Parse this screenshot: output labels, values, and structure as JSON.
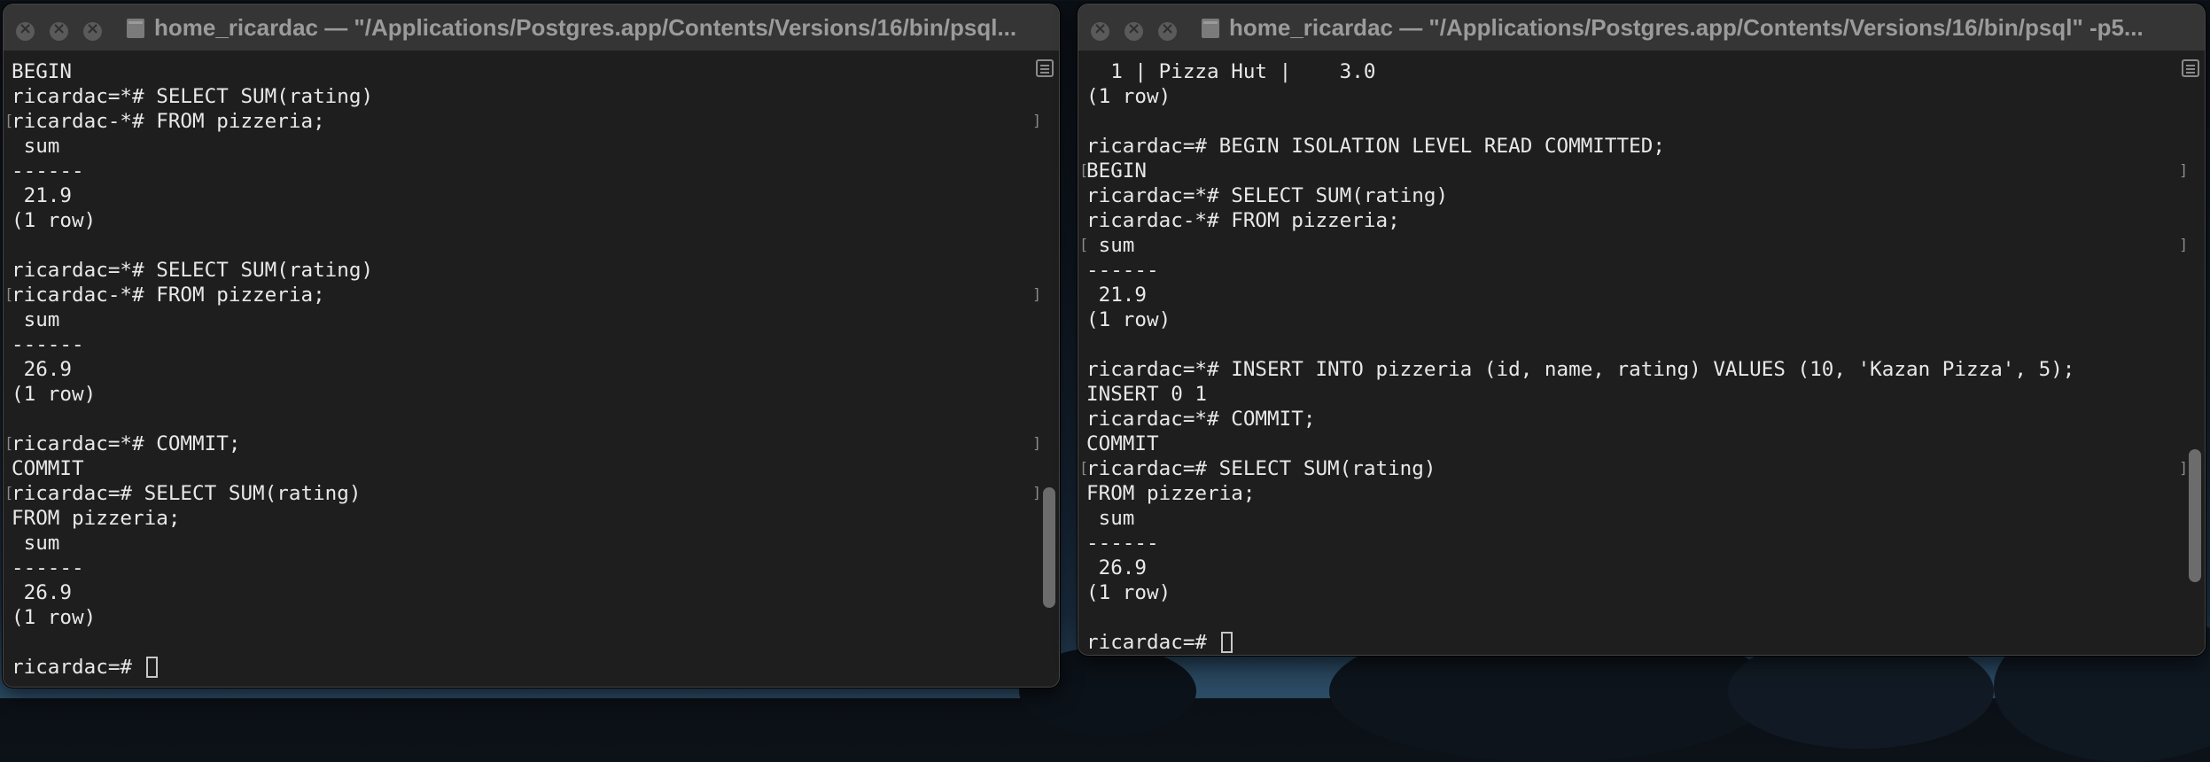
{
  "windows": [
    {
      "title": "home_ricardac — \"/Applications/Postgres.app/Contents/Versions/16/bin/psql...",
      "lines": [
        {
          "text": "BEGIN",
          "bracketed": false
        },
        {
          "text": "ricardac=*# SELECT SUM(rating)",
          "bracketed": false
        },
        {
          "text": "ricardac-*# FROM pizzeria;",
          "bracketed": true
        },
        {
          "text": " sum",
          "bracketed": false
        },
        {
          "text": "------",
          "bracketed": false
        },
        {
          "text": " 21.9",
          "bracketed": false
        },
        {
          "text": "(1 row)",
          "bracketed": false
        },
        {
          "text": "",
          "bracketed": false
        },
        {
          "text": "ricardac=*# SELECT SUM(rating)",
          "bracketed": false
        },
        {
          "text": "ricardac-*# FROM pizzeria;",
          "bracketed": true
        },
        {
          "text": " sum",
          "bracketed": false
        },
        {
          "text": "------",
          "bracketed": false
        },
        {
          "text": " 26.9",
          "bracketed": false
        },
        {
          "text": "(1 row)",
          "bracketed": false
        },
        {
          "text": "",
          "bracketed": false
        },
        {
          "text": "ricardac=*# COMMIT;",
          "bracketed": true
        },
        {
          "text": "COMMIT",
          "bracketed": false
        },
        {
          "text": "ricardac=# SELECT SUM(rating)",
          "bracketed": true
        },
        {
          "text": "FROM pizzeria;",
          "bracketed": false
        },
        {
          "text": " sum",
          "bracketed": false
        },
        {
          "text": "------",
          "bracketed": false
        },
        {
          "text": " 26.9",
          "bracketed": false
        },
        {
          "text": "(1 row)",
          "bracketed": false
        },
        {
          "text": "",
          "bracketed": false
        },
        {
          "text": "ricardac=# ",
          "bracketed": false,
          "cursor": true
        }
      ],
      "scroll_position": 0.85
    },
    {
      "title": "home_ricardac — \"/Applications/Postgres.app/Contents/Versions/16/bin/psql\" -p5...",
      "lines": [
        {
          "text": "  1 | Pizza Hut |    3.0",
          "bracketed": false
        },
        {
          "text": "(1 row)",
          "bracketed": false
        },
        {
          "text": "",
          "bracketed": false
        },
        {
          "text": "ricardac=# BEGIN ISOLATION LEVEL READ COMMITTED;",
          "bracketed": false
        },
        {
          "text": "BEGIN",
          "bracketed": true
        },
        {
          "text": "ricardac=*# SELECT SUM(rating)",
          "bracketed": false
        },
        {
          "text": "ricardac-*# FROM pizzeria;",
          "bracketed": false
        },
        {
          "text": " sum",
          "bracketed": true
        },
        {
          "text": "------",
          "bracketed": false
        },
        {
          "text": " 21.9",
          "bracketed": false
        },
        {
          "text": "(1 row)",
          "bracketed": false
        },
        {
          "text": "",
          "bracketed": false
        },
        {
          "text": "ricardac=*# INSERT INTO pizzeria (id, name, rating) VALUES (10, 'Kazan Pizza', 5);",
          "bracketed": false
        },
        {
          "text": "INSERT 0 1",
          "bracketed": false
        },
        {
          "text": "ricardac=*# COMMIT;",
          "bracketed": false
        },
        {
          "text": "COMMIT",
          "bracketed": false
        },
        {
          "text": "ricardac=# SELECT SUM(rating)",
          "bracketed": true
        },
        {
          "text": "FROM pizzeria;",
          "bracketed": false
        },
        {
          "text": " sum",
          "bracketed": false
        },
        {
          "text": "------",
          "bracketed": false
        },
        {
          "text": " 26.9",
          "bracketed": false
        },
        {
          "text": "(1 row)",
          "bracketed": false
        },
        {
          "text": "",
          "bracketed": false
        },
        {
          "text": "ricardac=# ",
          "bracketed": false,
          "cursor": true
        }
      ],
      "scroll_position": 0.85
    }
  ],
  "icons": {
    "traffic_lights": [
      "close-icon",
      "minimize-icon",
      "zoom-icon"
    ],
    "title_icon": "folder-icon",
    "marks_icon": "marks-icon"
  },
  "colors": {
    "terminal_bg": "#1e1e1e",
    "terminal_text": "#e8e8e8",
    "titlebar_bg": "#353535",
    "title_text": "#9b9b9b",
    "scroll_thumb": "#6c6c6c"
  }
}
